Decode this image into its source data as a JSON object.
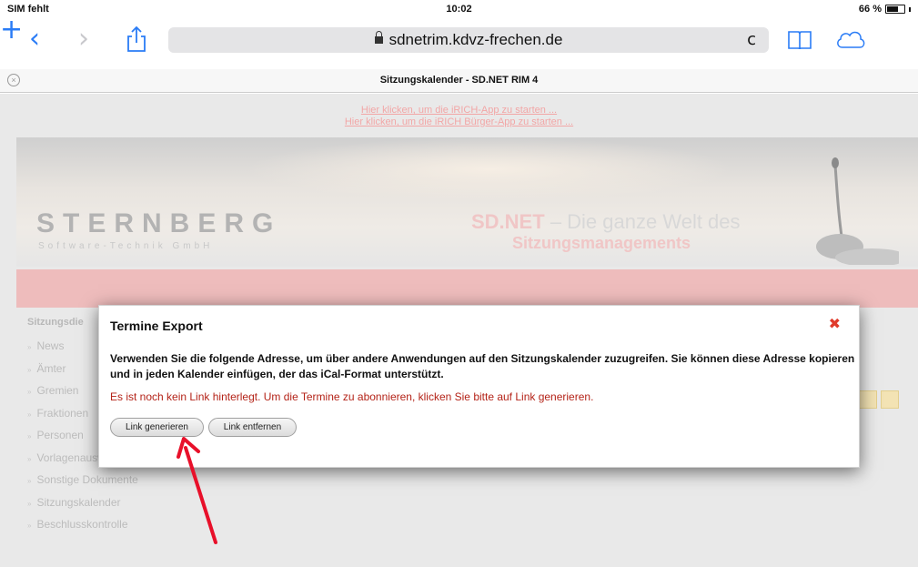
{
  "status_bar": {
    "carrier": "SIM fehlt",
    "time": "10:02",
    "battery": "66 %"
  },
  "browser": {
    "url": "sdnetrim.kdvz-frechen.de",
    "back_label": "‹",
    "forward_label": "›",
    "reload_label": "c",
    "new_tab_label": "+"
  },
  "tab": {
    "title": "Sitzungskalender - SD.NET RIM 4",
    "close_label": "×"
  },
  "page": {
    "app_links": [
      "Hier klicken, um die iRICH-App zu starten ...",
      "Hier klicken, um die iRICH Bürger-App zu starten ..."
    ],
    "banner": {
      "logo": "STERNBERG",
      "logo_sub": "Software-Technik GmbH",
      "brand": "SD.NET",
      "tagline_1": "– Die ganze Welt des",
      "tagline_2": "Sitzungsmanagements"
    },
    "sidebar": {
      "title": "Sitzungsdie",
      "items": [
        "News",
        "Ämter",
        "Gremien",
        "Fraktionen",
        "Personen",
        "Vorlagenauswahl",
        "Sonstige Dokumente",
        "Sitzungskalender",
        "Beschlusskontrolle"
      ]
    }
  },
  "modal": {
    "title": "Termine Export",
    "close_label": "✖",
    "description": "Verwenden Sie die folgende Adresse, um über andere Anwendungen auf den Sitzungskalender zuzugreifen. Sie können diese Adresse kopieren und in jeden Kalender einfügen, der das iCal-Format unterstützt.",
    "warning": "Es ist noch kein Link hinterlegt. Um die Termine zu abonnieren, klicken Sie bitte auf Link generieren.",
    "generate_label": "Link generieren",
    "remove_label": "Link entfernen"
  },
  "colors": {
    "accent": "#2a7cf6",
    "warning": "#b42318",
    "arrow": "#e8102a"
  }
}
